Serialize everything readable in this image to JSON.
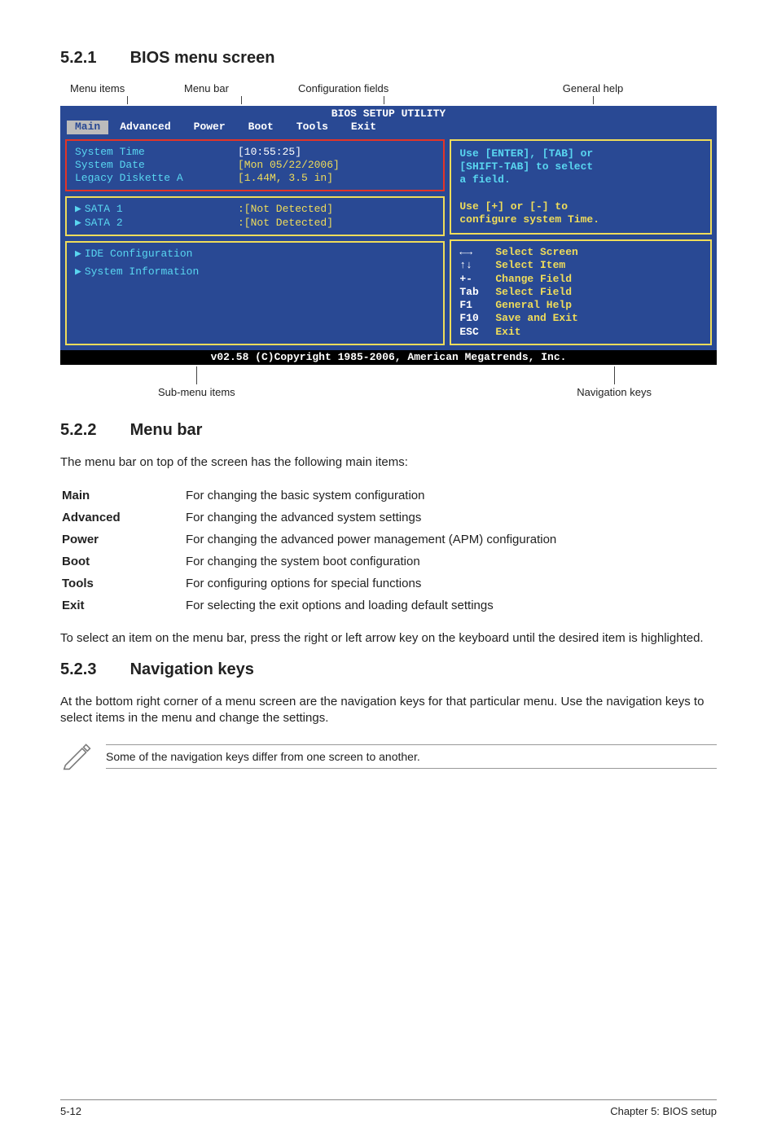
{
  "headings": {
    "h521": "5.2.1",
    "h521_title": "BIOS menu screen",
    "h522": "5.2.2",
    "h522_title": "Menu bar",
    "h523": "5.2.3",
    "h523_title": "Navigation keys"
  },
  "diagram_labels": {
    "menu_items": "Menu items",
    "menu_bar": "Menu bar",
    "config_fields": "Configuration fields",
    "general_help": "General help",
    "sub_menu_items": "Sub-menu items",
    "nav_keys": "Navigation keys"
  },
  "bios": {
    "title": "BIOS SETUP UTILITY",
    "menubar": [
      "Main",
      "Advanced",
      "Power",
      "Boot",
      "Tools",
      "Exit"
    ],
    "left_top": [
      {
        "k": "System Time",
        "v": "[10:55:25]",
        "hl": true
      },
      {
        "k": "System Date",
        "v": "[Mon 05/22/2006]"
      },
      {
        "k": "Legacy Diskette A",
        "v": "[1.44M, 3.5 in]"
      }
    ],
    "left_mid": [
      {
        "k": "SATA 1",
        "v": ":[Not Detected]"
      },
      {
        "k": "SATA 2",
        "v": ":[Not Detected]"
      }
    ],
    "left_bot": [
      "IDE Configuration",
      "System Information"
    ],
    "help_lines": [
      "Use [ENTER], [TAB] or",
      "[SHIFT-TAB] to select",
      "a field.",
      "",
      "Use [+] or [-] to",
      "configure system Time."
    ],
    "nav": [
      {
        "key": "←→",
        "label": "Select Screen"
      },
      {
        "key": "↑↓",
        "label": "Select Item"
      },
      {
        "key": "+-",
        "label": "Change Field"
      },
      {
        "key": "Tab",
        "label": "Select Field"
      },
      {
        "key": "F1",
        "label": "General Help"
      },
      {
        "key": "F10",
        "label": "Save and Exit"
      },
      {
        "key": "ESC",
        "label": "Exit"
      }
    ],
    "footer": "v02.58 (C)Copyright 1985-2006, American Megatrends, Inc."
  },
  "menu_bar_intro": "The menu bar on top of the screen has the following main items:",
  "menu_bar_items": [
    {
      "k": "Main",
      "v": "For changing the basic system configuration"
    },
    {
      "k": "Advanced",
      "v": "For changing the advanced system settings"
    },
    {
      "k": "Power",
      "v": "For changing the advanced power management (APM) configuration"
    },
    {
      "k": "Boot",
      "v": "For changing the system boot configuration"
    },
    {
      "k": "Tools",
      "v": "For configuring options for special functions"
    },
    {
      "k": "Exit",
      "v": "For selecting the exit options and loading default settings"
    }
  ],
  "menu_bar_outro": "To select an item on the menu bar, press the right or left arrow key on the keyboard until the desired item is highlighted.",
  "nav_keys_text": "At the bottom right corner of a menu screen are the navigation keys for that particular menu. Use the navigation keys to select items in the menu and change the settings.",
  "note_text": "Some of the navigation keys differ from one screen to another.",
  "footer": {
    "left": "5-12",
    "right": "Chapter 5: BIOS setup"
  }
}
